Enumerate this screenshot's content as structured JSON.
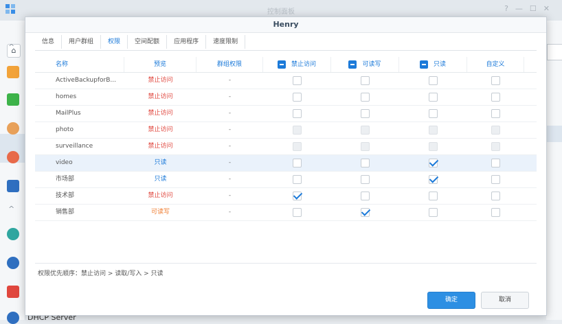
{
  "background": {
    "window_title": "控制面板",
    "bottom_item": "DHCP Server",
    "window_buttons": [
      "?",
      "—",
      "☐",
      "✕"
    ]
  },
  "dialog": {
    "title": "Henry",
    "tabs": [
      "信息",
      "用户群组",
      "权限",
      "空间配额",
      "应用程序",
      "速度限制"
    ],
    "active_tab": 2,
    "columns": {
      "name": "名称",
      "preview": "预览",
      "group_perm": "群组权限",
      "no_access": "禁止访问",
      "read_write": "可读写",
      "read_only": "只读",
      "custom": "自定义"
    },
    "rows": [
      {
        "name": "ActiveBackupforB...",
        "preview": "禁止访问",
        "preview_color": "#e0473e",
        "group": "-",
        "no_access": false,
        "read_write": false,
        "read_only": false,
        "custom": false,
        "disabled": false,
        "selected": false
      },
      {
        "name": "homes",
        "preview": "禁止访问",
        "preview_color": "#e0473e",
        "group": "-",
        "no_access": false,
        "read_write": false,
        "read_only": false,
        "custom": false,
        "disabled": false,
        "selected": false
      },
      {
        "name": "MailPlus",
        "preview": "禁止访问",
        "preview_color": "#e0473e",
        "group": "-",
        "no_access": false,
        "read_write": false,
        "read_only": false,
        "custom": false,
        "disabled": false,
        "selected": false
      },
      {
        "name": "photo",
        "preview": "禁止访问",
        "preview_color": "#e0473e",
        "group": "-",
        "no_access": false,
        "read_write": false,
        "read_only": false,
        "custom": false,
        "disabled": true,
        "selected": false
      },
      {
        "name": "surveillance",
        "preview": "禁止访问",
        "preview_color": "#e0473e",
        "group": "-",
        "no_access": false,
        "read_write": false,
        "read_only": false,
        "custom": false,
        "disabled": true,
        "selected": false
      },
      {
        "name": "video",
        "preview": "只读",
        "preview_color": "#1c7ad9",
        "group": "-",
        "no_access": false,
        "read_write": false,
        "read_only": true,
        "custom": false,
        "disabled": false,
        "selected": true
      },
      {
        "name": "市场部",
        "preview": "只读",
        "preview_color": "#1c7ad9",
        "group": "-",
        "no_access": false,
        "read_write": false,
        "read_only": true,
        "custom": false,
        "disabled": false,
        "selected": false
      },
      {
        "name": "技术部",
        "preview": "禁止访问",
        "preview_color": "#e0473e",
        "group": "-",
        "no_access": true,
        "read_write": false,
        "read_only": false,
        "custom": false,
        "disabled": false,
        "selected": false
      },
      {
        "name": "销售部",
        "preview": "可读写",
        "preview_color": "#ef7b2e",
        "group": "-",
        "no_access": false,
        "read_write": true,
        "read_only": false,
        "custom": false,
        "disabled": false,
        "selected": false
      }
    ],
    "priority_note": "权限优先顺序：禁止访问 > 读取/写入 > 只读",
    "ok_label": "确定",
    "cancel_label": "取消"
  },
  "colors": {
    "accent": "#1c7ad9",
    "deny": "#e0473e",
    "read_write": "#ef7b2e",
    "ok_button": "#2d8fe3"
  }
}
